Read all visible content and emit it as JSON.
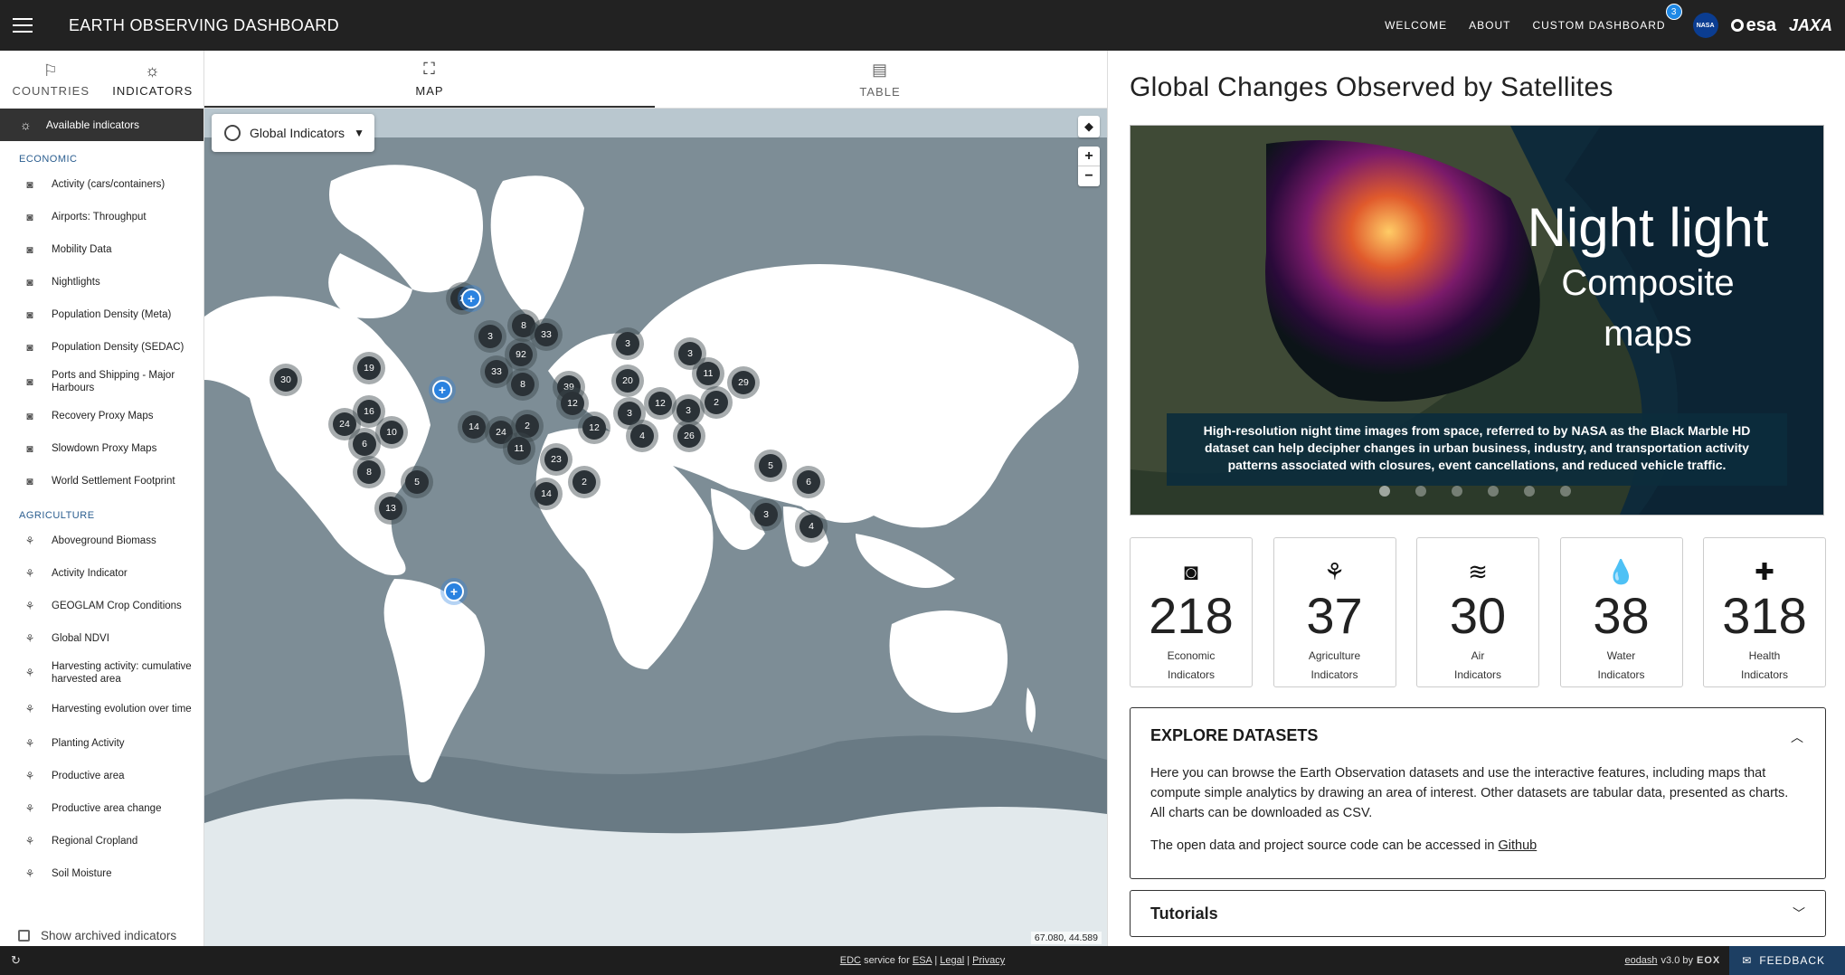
{
  "app": {
    "title": "EARTH OBSERVING DASHBOARD"
  },
  "topnav": {
    "links": [
      "WELCOME",
      "ABOUT",
      "CUSTOM DASHBOARD"
    ],
    "custom_dashboard_badge": "3",
    "logos": {
      "nasa": "NASA",
      "esa": "esa",
      "jaxa": "JAXA"
    }
  },
  "left_tabs": [
    {
      "label": "COUNTRIES",
      "icon": "flag-icon"
    },
    {
      "label": "INDICATORS",
      "icon": "lightbulb-icon"
    }
  ],
  "indicators": {
    "header": "Available indicators",
    "groups": [
      {
        "name": "ECONOMIC",
        "items": [
          "Activity (cars/containers)",
          "Airports: Throughput",
          "Mobility Data",
          "Nightlights",
          "Population Density (Meta)",
          "Population Density (SEDAC)",
          "Ports and Shipping - Major Harbours",
          "Recovery Proxy Maps",
          "Slowdown Proxy Maps",
          "World Settlement Footprint"
        ]
      },
      {
        "name": "AGRICULTURE",
        "items": [
          "Aboveground Biomass",
          "Activity Indicator",
          "GEOGLAM Crop Conditions",
          "Global NDVI",
          "Harvesting activity: cumulative harvested area",
          "Harvesting evolution over time",
          "Planting Activity",
          "Productive area",
          "Productive area change",
          "Regional Cropland",
          "Soil Moisture"
        ]
      }
    ],
    "archived_label": "Show archived indicators"
  },
  "map_tabs": [
    {
      "label": "MAP",
      "icon": "map-search-icon"
    },
    {
      "label": "TABLE",
      "icon": "table-search-icon"
    }
  ],
  "map": {
    "selector_label": "Global Indicators",
    "coordinates": "67.080, 44.589",
    "clusters": [
      "2",
      "3",
      "8",
      "33",
      "92",
      "33",
      "8",
      "39",
      "3",
      "3",
      "11",
      "29",
      "19",
      "30",
      "24",
      "16",
      "10",
      "6",
      "8",
      "5",
      "13",
      "14",
      "24",
      "2",
      "11",
      "12",
      "12",
      "20",
      "3",
      "4",
      "12",
      "3",
      "26",
      "2",
      "23",
      "14",
      "2",
      "5",
      "6",
      "3",
      "4"
    ],
    "health_pins": 3
  },
  "panel": {
    "title": "Global Changes Observed by Satellites",
    "banner": {
      "title_line1": "Night light",
      "title_line2": "Composite",
      "title_line3": "maps",
      "description": "High-resolution night time images from space, referred to by NASA as the Black Marble HD dataset can help decipher changes in urban business, industry, and transportation activity patterns associated with closures, event cancellations, and reduced vehicle traffic.",
      "slides": 6,
      "active_slide": 1
    },
    "stats": [
      {
        "value": "218",
        "label1": "Economic",
        "label2": "Indicators",
        "icon": "economic-icon"
      },
      {
        "value": "37",
        "label1": "Agriculture",
        "label2": "Indicators",
        "icon": "agriculture-icon"
      },
      {
        "value": "30",
        "label1": "Air",
        "label2": "Indicators",
        "icon": "air-icon"
      },
      {
        "value": "38",
        "label1": "Water",
        "label2": "Indicators",
        "icon": "water-icon"
      },
      {
        "value": "318",
        "label1": "Health",
        "label2": "Indicators",
        "icon": "health-icon"
      }
    ],
    "explore": {
      "title": "EXPLORE DATASETS",
      "p1": "Here you can browse the Earth Observation datasets and use the interactive features, including maps that compute simple analytics by drawing an area of interest. Other datasets are tabular data, presented as charts. All charts can be downloaded as CSV.",
      "p2_prefix": "The open data and project source code can be accessed in",
      "p2_link": "Github"
    },
    "tutorials": {
      "title": "Tutorials"
    }
  },
  "footer": {
    "edc": "EDC",
    "service_for": "service for",
    "esa": "ESA",
    "legal": "Legal",
    "privacy": "Privacy",
    "eodash": "eodash",
    "version": "v3.0 by",
    "eox": "EOX",
    "feedback": "FEEDBACK"
  },
  "colors": {
    "topbar": "#222222",
    "cluster": "#2b3237",
    "health_pin": "#2a82e0",
    "feedback": "#1d3f63"
  }
}
